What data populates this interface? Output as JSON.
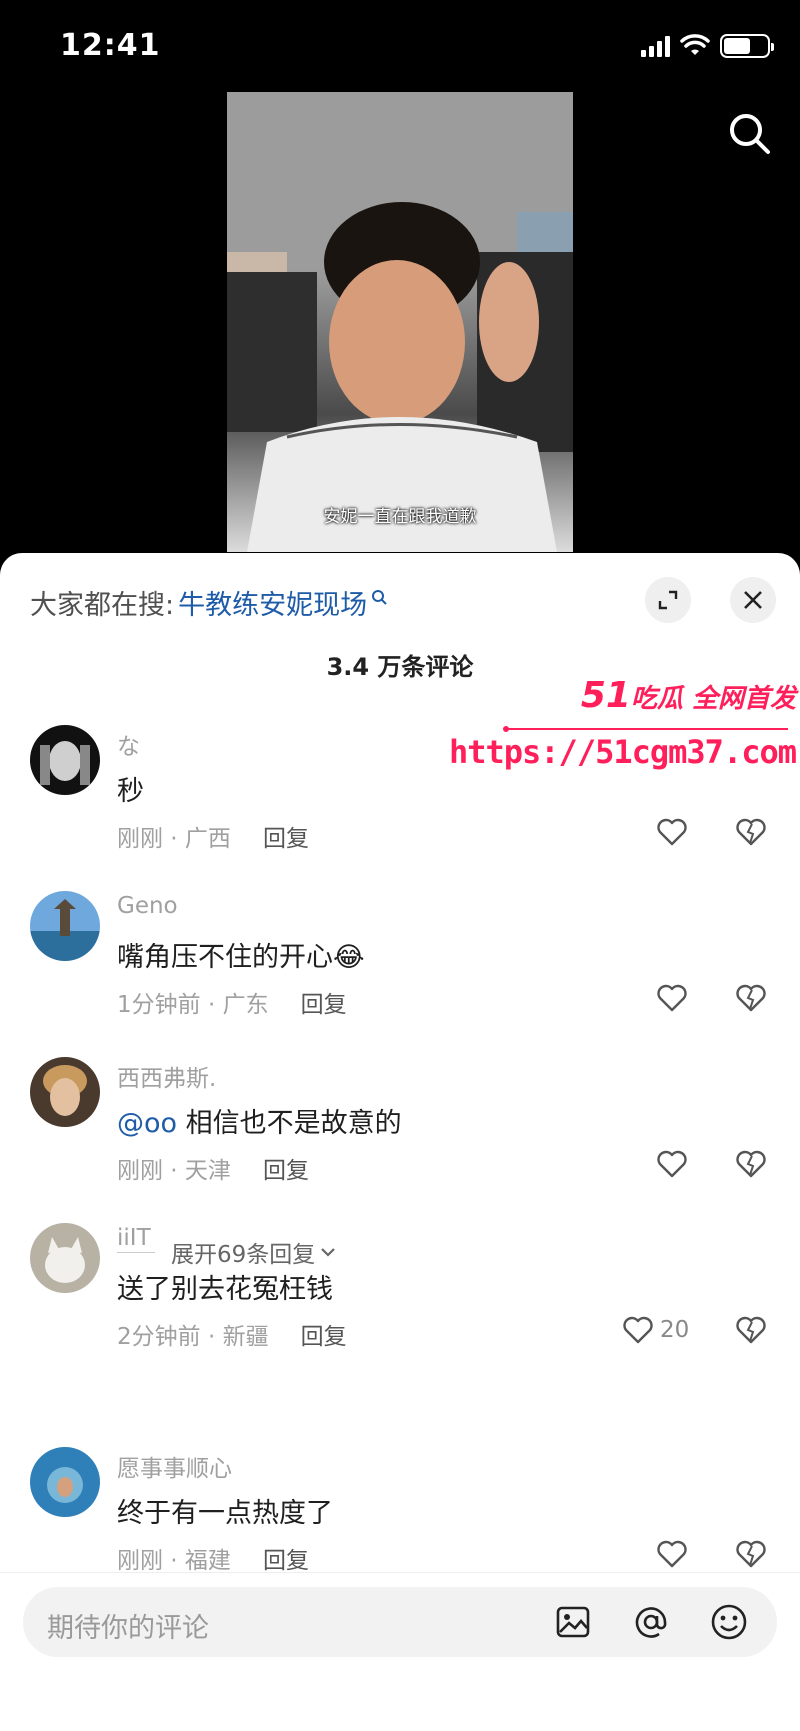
{
  "status": {
    "time": "12:41"
  },
  "video": {
    "subtitle": "安妮一直在跟我道歉"
  },
  "panel": {
    "hot_search_label": "大家都在搜:",
    "hot_search_term": "牛教练安妮现场",
    "comment_count": "3.4 万条评论"
  },
  "comments": [
    {
      "user": "な",
      "text": "秒",
      "mention": "",
      "time_loc": "刚刚 · 广西",
      "reply": "回复",
      "likes": ""
    },
    {
      "user": "Geno",
      "text": "嘴角压不住的开心😂",
      "mention": "",
      "time_loc": "1分钟前 · 广东",
      "reply": "回复",
      "likes": ""
    },
    {
      "user": "西西弗斯.",
      "text": " 相信也不是故意的",
      "mention": "@oo",
      "time_loc": "刚刚 · 天津",
      "reply": "回复",
      "likes": ""
    },
    {
      "user": "iiIT",
      "text": "送了别去花冤枉钱",
      "mention": "",
      "time_loc": "2分钟前 · 新疆",
      "reply": "回复",
      "likes": "20"
    },
    {
      "user": "愿事事顺心",
      "text": "终于有一点热度了",
      "mention": "",
      "time_loc": "刚刚 · 福建",
      "reply": "回复",
      "likes": ""
    }
  ],
  "expand_replies": "展开69条回复",
  "watermark": {
    "brand": "51",
    "slogan": "吃瓜 全网首发",
    "url": "https://51cgm37.com"
  },
  "input": {
    "placeholder": "期待你的评论"
  },
  "colors": {
    "accent": "#1f5ca8",
    "watermark": "#ff1f5a"
  }
}
